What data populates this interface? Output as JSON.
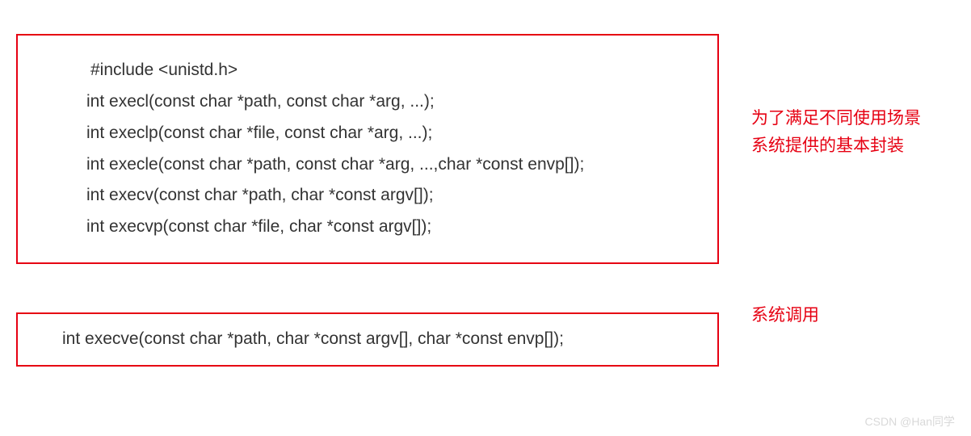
{
  "box1": {
    "lines": [
      " #include <unistd.h>",
      "int execl(const char *path, const char *arg, ...);",
      "int execlp(const char *file, const char *arg, ...);",
      "int execle(const char *path, const char *arg, ...,char *const envp[]);",
      "int execv(const char *path, char *const argv[]);",
      "int execvp(const char *file, char *const argv[]);"
    ]
  },
  "annotation1": {
    "line1": "为了满足不同使用场景",
    "line2": "系统提供的基本封装"
  },
  "box2": {
    "line": "int execve(const char *path, char *const argv[], char *const envp[]);"
  },
  "annotation2": {
    "text": "系统调用"
  },
  "watermark": "CSDN @Han同学"
}
